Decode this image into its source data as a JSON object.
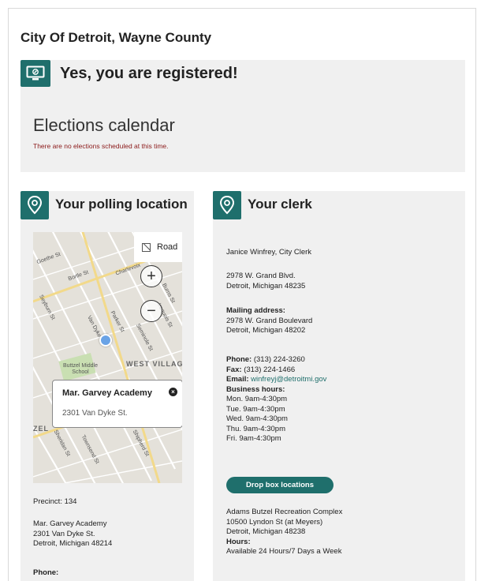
{
  "page": {
    "title": "City Of Detroit, Wayne County"
  },
  "registration": {
    "status_title": "Yes, you are registered!",
    "calendar_title": "Elections calendar",
    "calendar_note": "There are no elections scheduled at this time."
  },
  "polling": {
    "section_title": "Your polling location",
    "map": {
      "road_button_label": "Road",
      "zoom_in_label": "+",
      "zoom_out_label": "−",
      "labels": [
        "Goethe St",
        "Bortle St",
        "Charlevoix",
        "Burns St",
        "Seyburn St",
        "Van Dyke St",
        "Parker St",
        "Iroquois St",
        "Seminole St",
        "Buttzel Middle School",
        "WEST VILLAGE",
        "ZEL",
        "Sheridan St",
        "Townsend St",
        "Shipherd St"
      ],
      "popup": {
        "name": "Mar. Garvey Academy",
        "close_label": "×",
        "address": "2301 Van Dyke St."
      }
    },
    "precinct": "Precinct: 134",
    "location_name": "Mar. Garvey Academy",
    "address_line1": "2301 Van Dyke St.",
    "address_line2": "Detroit, Michigan 48214",
    "phone_label": "Phone:"
  },
  "clerk": {
    "section_title": "Your clerk",
    "name": "Janice Winfrey, City Clerk",
    "address_line1": "2978 W. Grand Blvd.",
    "address_line2": "Detroit, Michigan 48235",
    "mailing_label": "Mailing address:",
    "mailing_line1": "2978 W. Grand Boulevard",
    "mailing_line2": "Detroit, Michigan 48202",
    "phone_label": "Phone:",
    "phone": "(313) 224-3260",
    "fax_label": "Fax:",
    "fax": "(313) 224-1466",
    "email_label": "Email:",
    "email": "winfreyj@detroitmi.gov",
    "hours_label": "Business hours:",
    "hours": [
      "Mon. 9am-4:30pm",
      "Tue. 9am-4:30pm",
      "Wed. 9am-4:30pm",
      "Thu. 9am-4:30pm",
      "Fri. 9am-4:30pm"
    ],
    "drop_box_button": "Drop box locations",
    "dropbox_name": "Adams Butzel Recreation Complex",
    "dropbox_line1": "10500 Lyndon St (at Meyers)",
    "dropbox_line2": "Detroit, Michigan 48238",
    "dropbox_hours_label": "Hours:",
    "dropbox_hours": "Available 24 Hours/7 Days a Week"
  },
  "colors": {
    "accent": "#1f6f6c",
    "panel_bg": "#f0f0f0",
    "alert_text": "#8b1a1a"
  }
}
